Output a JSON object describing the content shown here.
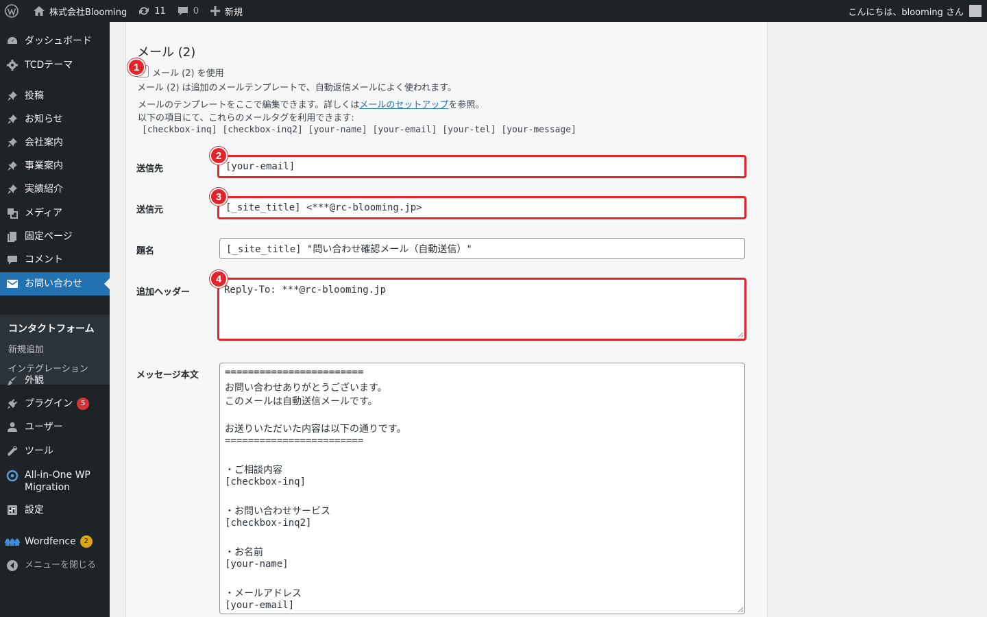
{
  "adminbar": {
    "site_name": "株式会社Blooming",
    "updates_count": "11",
    "comments_count": "0",
    "new_label": "新規",
    "greeting": "こんにちは、blooming さん"
  },
  "sidebar": {
    "items": [
      {
        "label": "ダッシュボード",
        "icon": "dashboard-icon"
      },
      {
        "label": "TCDテーマ",
        "icon": "gear-icon"
      },
      {
        "label": "投稿",
        "icon": "pin-icon"
      },
      {
        "label": "お知らせ",
        "icon": "pin-icon"
      },
      {
        "label": "会社案内",
        "icon": "pin-icon"
      },
      {
        "label": "事業案内",
        "icon": "pin-icon"
      },
      {
        "label": "実績紹介",
        "icon": "pin-icon"
      },
      {
        "label": "メディア",
        "icon": "media-icon"
      },
      {
        "label": "固定ページ",
        "icon": "page-icon"
      },
      {
        "label": "コメント",
        "icon": "comment-icon"
      },
      {
        "label": "お問い合わせ",
        "icon": "mail-icon"
      },
      {
        "label": "外観",
        "icon": "brush-icon"
      },
      {
        "label": "プラグイン",
        "icon": "plugin-icon",
        "badge": "5"
      },
      {
        "label": "ユーザー",
        "icon": "user-icon"
      },
      {
        "label": "ツール",
        "icon": "wrench-icon"
      },
      {
        "label": "All-in-One WP",
        "label2": "Migration",
        "icon": "migration-icon"
      },
      {
        "label": "設定",
        "icon": "settings-icon"
      },
      {
        "label": "Wordfence",
        "icon": "wordfence-icon",
        "badge": "2"
      },
      {
        "label": "メニューを閉じる",
        "icon": "collapse-icon"
      }
    ],
    "submenu": [
      {
        "label": "コンタクトフォーム"
      },
      {
        "label": "新規追加"
      },
      {
        "label": "インテグレーション"
      }
    ]
  },
  "mail": {
    "heading": "メール (2)",
    "use_label": "メール (2) を使用",
    "desc": "メール (2) は追加のメールテンプレートで、自動返信メールによく使われます。",
    "edit_pre": "メールのテンプレートをここで編集できます。詳しくは",
    "edit_link": "メールのセットアップ",
    "edit_post": "を参照。",
    "tags_intro": "以下の項目にて、これらのメールタグを利用できます:",
    "tags": "[checkbox-inq] [checkbox-inq2] [your-name] [your-email] [your-tel] [your-message]",
    "to_label": "送信先",
    "to_value": "[your-email]",
    "from_label": "送信元",
    "from_value": "[_site_title] <***@rc-blooming.jp>",
    "subject_label": "題名",
    "subject_value": "[_site_title] \"問い合わせ確認メール（自動送信）\"",
    "headers_label": "追加ヘッダー",
    "headers_value": "Reply-To: ***@rc-blooming.jp",
    "body_label": "メッセージ本文",
    "body_lines": [
      "========================",
      "お問い合わせありがとうございます。",
      "このメールは自動送信メールです。",
      "",
      "お送りいただいた内容は以下の通りです。",
      "========================",
      "",
      "・ご相談内容",
      "[checkbox-inq]",
      "",
      "・お問い合わせサービス",
      "[checkbox-inq2]",
      "",
      "・お名前",
      "[your-name]",
      "",
      "・メールアドレス",
      "[your-email]"
    ]
  },
  "annotations": [
    "1",
    "2",
    "3",
    "4"
  ],
  "colors": {
    "highlight": "#e3242b",
    "accent": "#2271b1",
    "sidebar": "#1d2327"
  }
}
